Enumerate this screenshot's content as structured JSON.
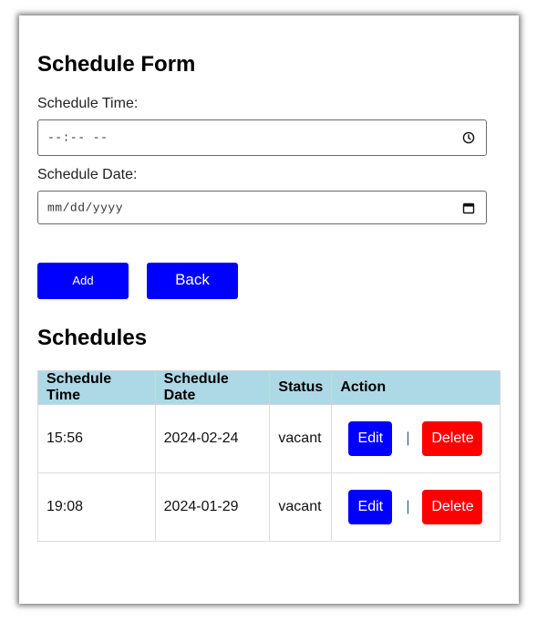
{
  "form": {
    "title": "Schedule Form",
    "time_label": "Schedule Time:",
    "time_value": "--:-- --",
    "date_label": "Schedule Date:",
    "date_value": "mm/dd/yyyy",
    "add_label": "Add",
    "back_label": "Back",
    "time_icon": "clock-icon",
    "date_icon": "calendar-icon"
  },
  "schedules": {
    "title": "Schedules",
    "columns": [
      "Schedule Time",
      "Schedule Date",
      "Status",
      "Action"
    ],
    "rows": [
      {
        "time": "15:56",
        "date": "2024-02-24",
        "status": "vacant",
        "edit": "Edit",
        "sep": "|",
        "delete": "Delete"
      },
      {
        "time": "19:08",
        "date": "2024-01-29",
        "status": "vacant",
        "edit": "Edit",
        "sep": "|",
        "delete": "Delete"
      }
    ]
  },
  "colors": {
    "primary": "#0000ff",
    "danger": "#ff0000",
    "header_bg": "#add8e6"
  }
}
